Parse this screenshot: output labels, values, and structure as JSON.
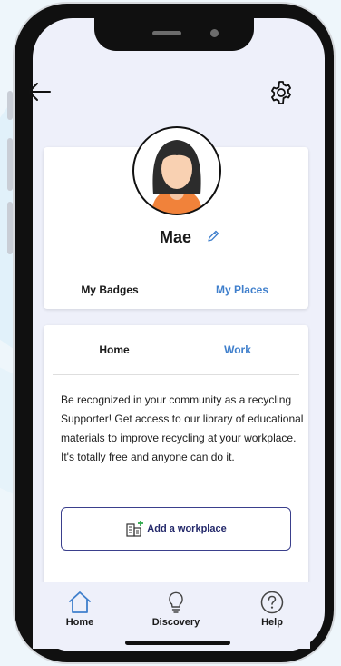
{
  "profile": {
    "name": "Mae",
    "tabs": [
      "My Badges",
      "My Places"
    ]
  },
  "places": {
    "tabs": [
      "Home",
      "Work"
    ],
    "description": "Be recognized in your community as a recycling Supporter! Get access to our library of educational materials to improve recycling at your workplace. It's totally free and anyone can do it.",
    "add_button_label": "Add a workplace"
  },
  "bottom_nav": {
    "items": [
      "Home",
      "Discovery",
      "Help"
    ]
  },
  "colors": {
    "accent": "#3f7fcc",
    "button_border": "#3a3f8c",
    "screen_bg": "#eef0fa"
  },
  "icons": {
    "back": "arrow-left-icon",
    "settings": "gear-icon",
    "edit": "pencil-icon",
    "add_workplace": "building-plus-icon",
    "nav_home": "house-icon",
    "nav_discovery": "lightbulb-icon",
    "nav_help": "question-circle-icon"
  }
}
